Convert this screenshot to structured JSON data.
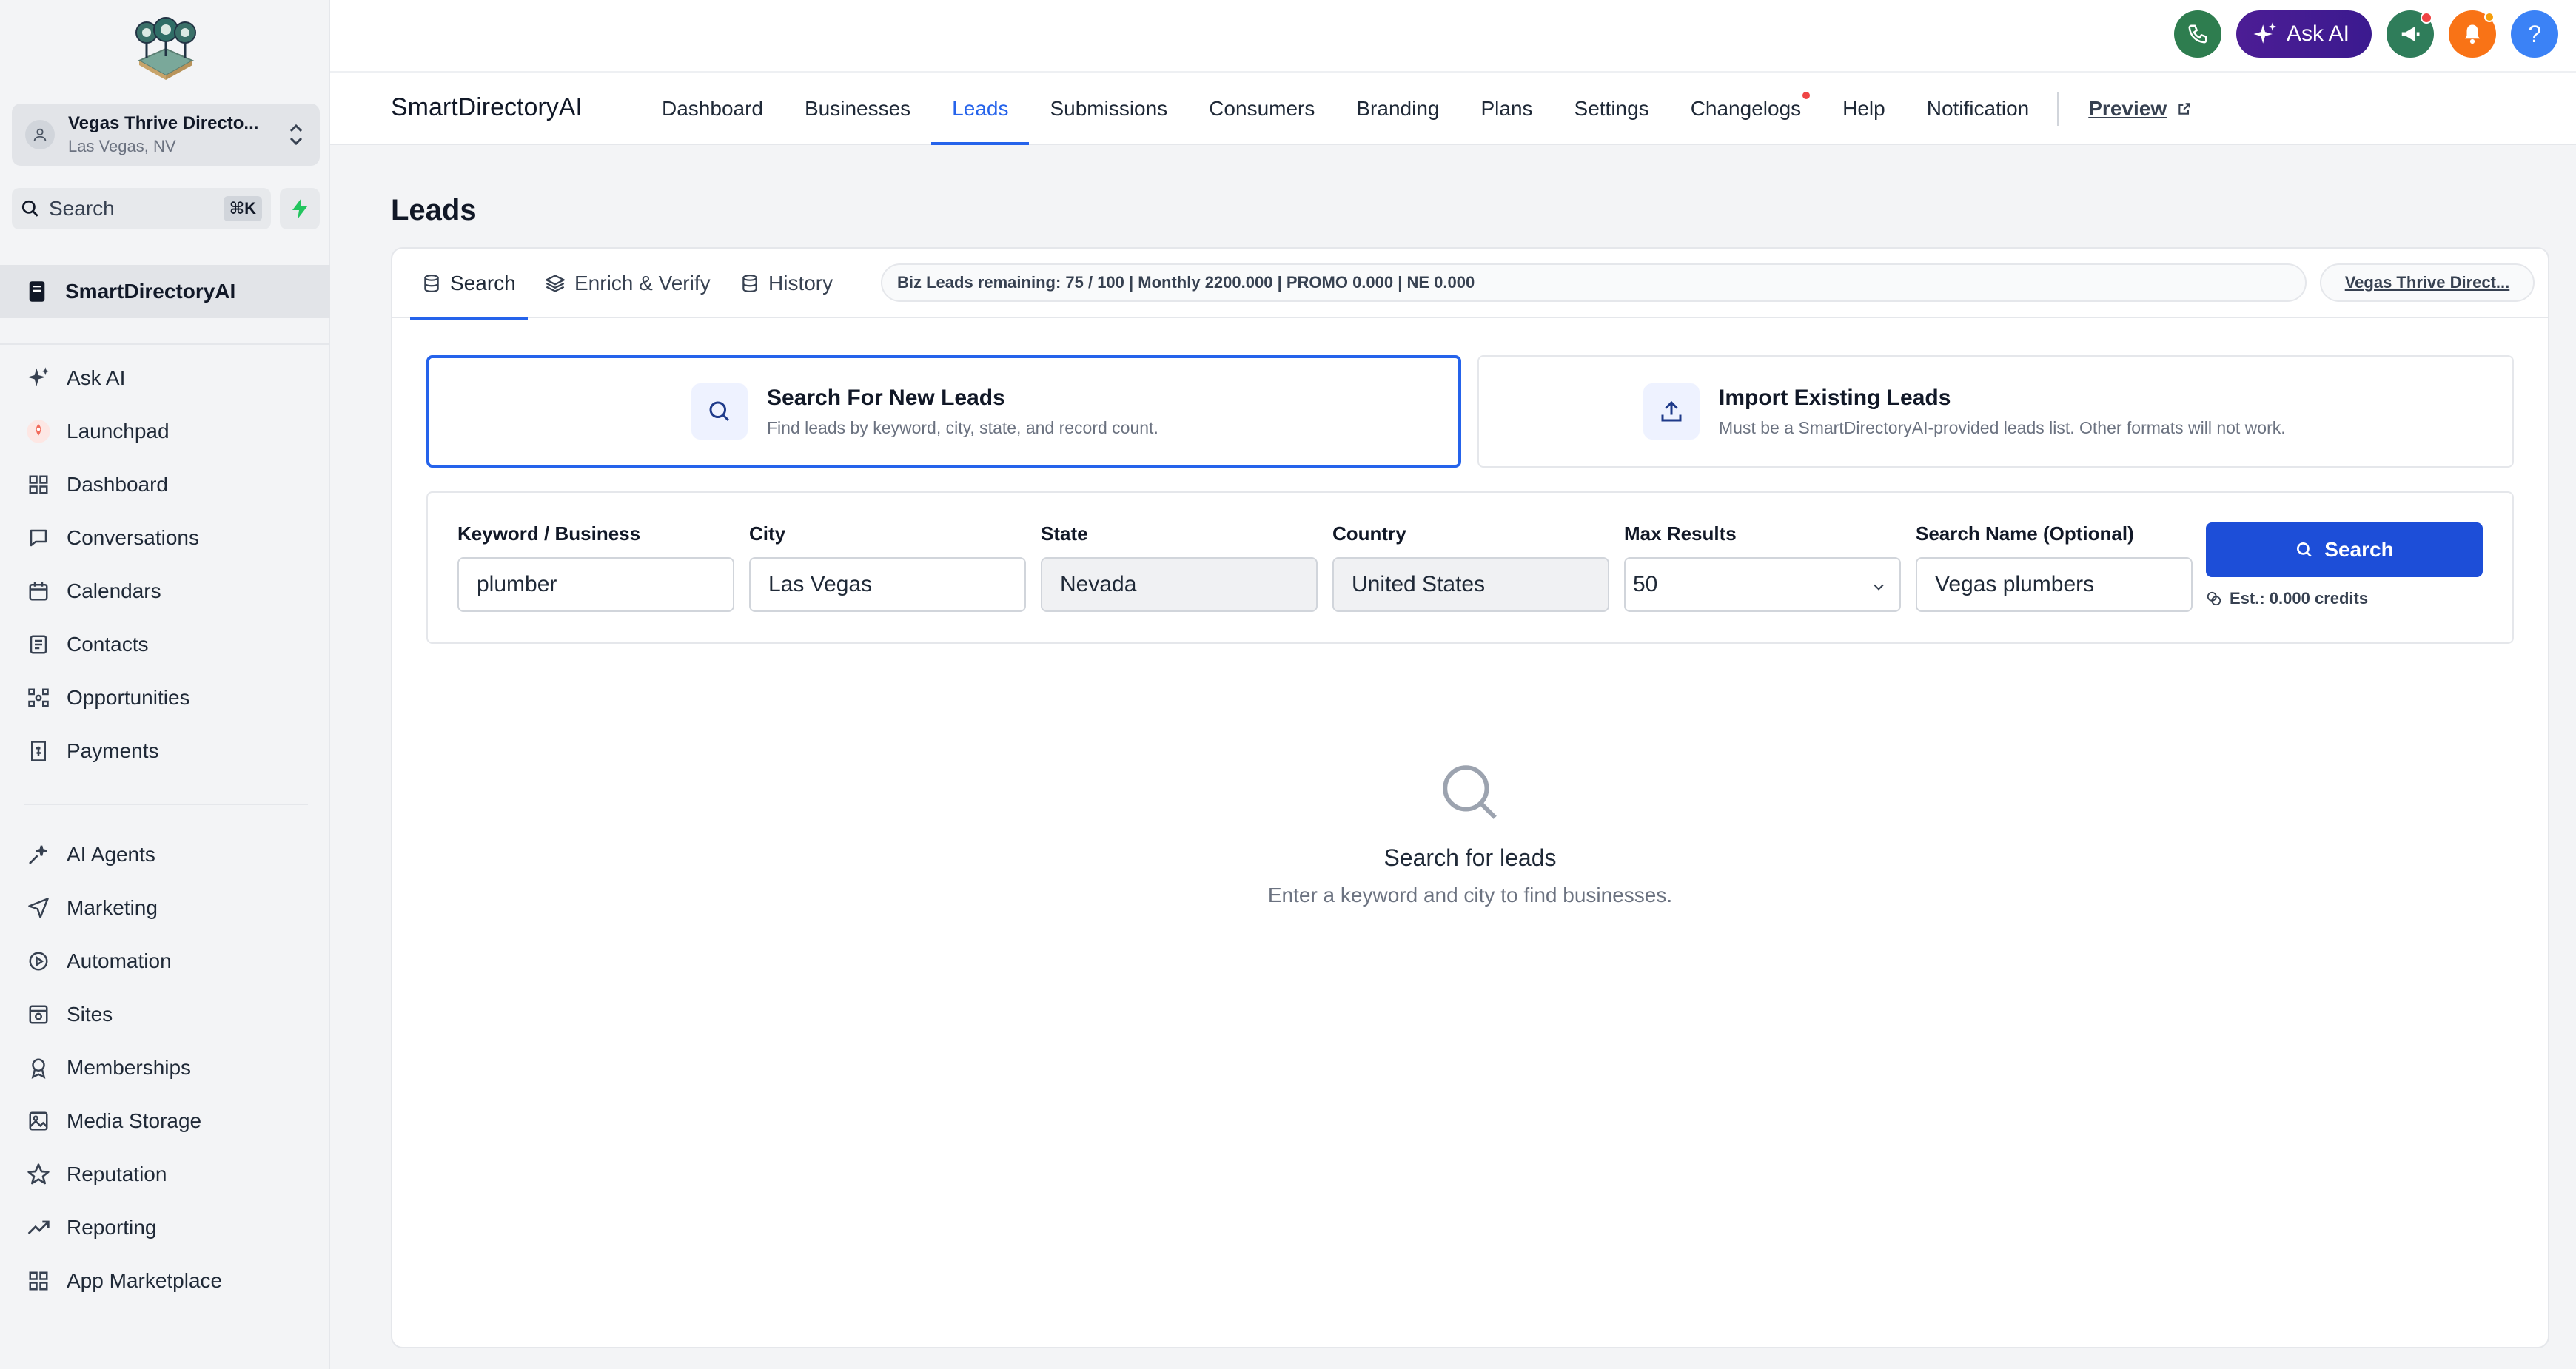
{
  "sidebar": {
    "location": {
      "name": "Vegas Thrive Directo...",
      "city": "Las Vegas, NV"
    },
    "search": {
      "label": "Search",
      "shortcut": "⌘K"
    },
    "brand_item": "SmartDirectoryAI",
    "items": [
      {
        "label": "Ask AI",
        "icon": "sparkle-icon"
      },
      {
        "label": "Launchpad",
        "icon": "rocket-icon"
      },
      {
        "label": "Dashboard",
        "icon": "grid-icon"
      },
      {
        "label": "Conversations",
        "icon": "chat-icon"
      },
      {
        "label": "Calendars",
        "icon": "calendar-icon"
      },
      {
        "label": "Contacts",
        "icon": "contacts-icon"
      },
      {
        "label": "Opportunities",
        "icon": "pipeline-icon"
      },
      {
        "label": "Payments",
        "icon": "receipt-icon"
      }
    ],
    "items2": [
      {
        "label": "AI Agents",
        "icon": "ai-agent-icon"
      },
      {
        "label": "Marketing",
        "icon": "send-icon"
      },
      {
        "label": "Automation",
        "icon": "automation-icon"
      },
      {
        "label": "Sites",
        "icon": "sites-icon"
      },
      {
        "label": "Memberships",
        "icon": "award-icon"
      },
      {
        "label": "Media Storage",
        "icon": "image-icon"
      },
      {
        "label": "Reputation",
        "icon": "star-icon"
      },
      {
        "label": "Reporting",
        "icon": "trend-icon"
      },
      {
        "label": "App Marketplace",
        "icon": "apps-icon"
      }
    ]
  },
  "topbar": {
    "ask_ai": "Ask AI",
    "help": "?"
  },
  "nav": {
    "brand": "SmartDirectoryAI",
    "tabs": [
      "Dashboard",
      "Businesses",
      "Leads",
      "Submissions",
      "Consumers",
      "Branding",
      "Plans",
      "Settings",
      "Changelogs",
      "Help",
      "Notification"
    ],
    "preview": "Preview"
  },
  "page": {
    "title": "Leads",
    "subtabs": [
      "Search",
      "Enrich & Verify",
      "History"
    ],
    "quota": "Biz Leads remaining: 75 / 100 | Monthly 2200.000 | PROMO 0.000 | NE 0.000",
    "location_pill": "Vegas Thrive Direct...",
    "options": [
      {
        "title": "Search For New Leads",
        "subtitle": "Find leads by keyword, city, state, and record count."
      },
      {
        "title": "Import Existing Leads",
        "subtitle": "Must be a SmartDirectoryAI-provided leads list. Other formats will not work."
      }
    ],
    "form": {
      "keyword": {
        "label": "Keyword / Business",
        "value": "plumber"
      },
      "city": {
        "label": "City",
        "value": "Las Vegas"
      },
      "state": {
        "label": "State",
        "value": "Nevada"
      },
      "country": {
        "label": "Country",
        "value": "United States"
      },
      "max_results": {
        "label": "Max Results",
        "value": "50"
      },
      "search_name": {
        "label": "Search Name (Optional)",
        "value": "Vegas plumbers"
      },
      "search_button": "Search",
      "estimate": "Est.: 0.000 credits"
    },
    "empty": {
      "title": "Search for leads",
      "subtitle": "Enter a keyword and city to find businesses."
    }
  },
  "colors": {
    "accent": "#2563eb",
    "primary_button": "#1d4ed8",
    "ask_ai": "#4c1d95",
    "phone": "#2e7d4f",
    "bell": "#f97316",
    "help": "#3b82f6"
  }
}
